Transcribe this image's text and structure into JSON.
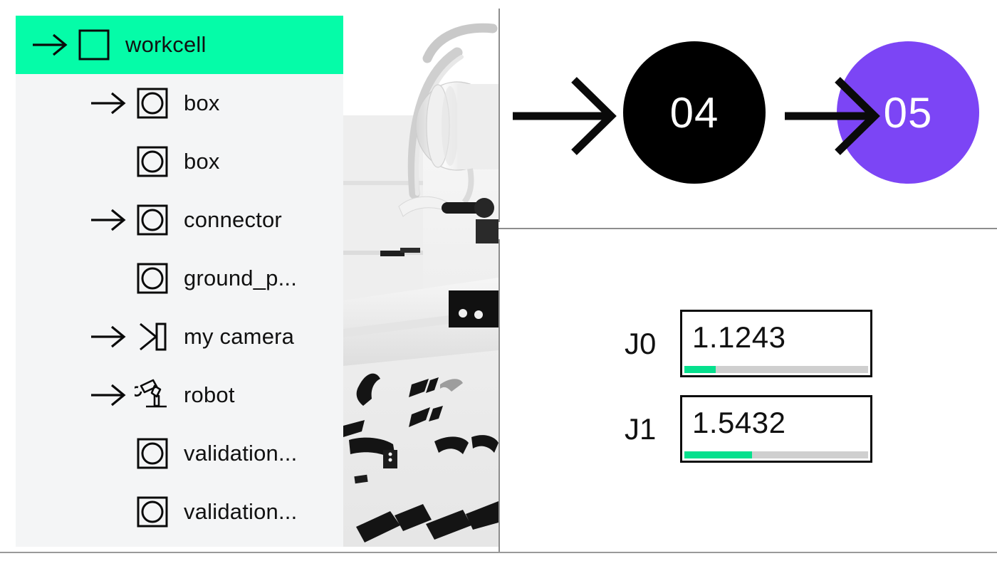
{
  "scene_tree": {
    "items": [
      {
        "label": "workcell",
        "icon": "square-frame-icon",
        "has_expander": true,
        "depth": 0,
        "selected": true
      },
      {
        "label": "box",
        "icon": "circle-in-square-icon",
        "has_expander": true,
        "depth": 1,
        "selected": false
      },
      {
        "label": "box",
        "icon": "circle-in-square-icon",
        "has_expander": false,
        "depth": 1,
        "selected": false
      },
      {
        "label": "connector",
        "icon": "circle-in-square-icon",
        "has_expander": true,
        "depth": 1,
        "selected": false
      },
      {
        "label": "ground_p...",
        "icon": "circle-in-square-icon",
        "has_expander": false,
        "depth": 1,
        "selected": false
      },
      {
        "label": "my camera",
        "icon": "camera-frustum-icon",
        "has_expander": true,
        "depth": 1,
        "selected": false
      },
      {
        "label": "robot",
        "icon": "robot-arm-icon",
        "has_expander": true,
        "depth": 1,
        "selected": false
      },
      {
        "label": "validation...",
        "icon": "circle-in-square-icon",
        "has_expander": false,
        "depth": 1,
        "selected": false
      },
      {
        "label": "validation...",
        "icon": "circle-in-square-icon",
        "has_expander": false,
        "depth": 1,
        "selected": false
      }
    ],
    "selected_color": "#05fca8",
    "panel_background": "#f4f5f6"
  },
  "viewport": {
    "name": "3d-robot-render",
    "description": "grayscale 3d rendering of a robot arm workcell"
  },
  "graph": {
    "nodes": [
      {
        "id": "node-04",
        "label": "04",
        "color": "#000000",
        "text_color": "#ffffff"
      },
      {
        "id": "node-05",
        "label": "05",
        "color": "#7c45f5",
        "text_color": "#ffffff"
      }
    ],
    "connectors": [
      {
        "name": "arrow-into-node-04"
      },
      {
        "name": "arrow-node-04-to-node-05"
      }
    ]
  },
  "joints": {
    "rows": [
      {
        "label": "J0",
        "value": "1.1243",
        "fill_percent": 17
      },
      {
        "label": "J1",
        "value": "1.5432",
        "fill_percent": 37
      }
    ],
    "fill_color": "#05e08d",
    "track_color": "#cfcfcf"
  }
}
